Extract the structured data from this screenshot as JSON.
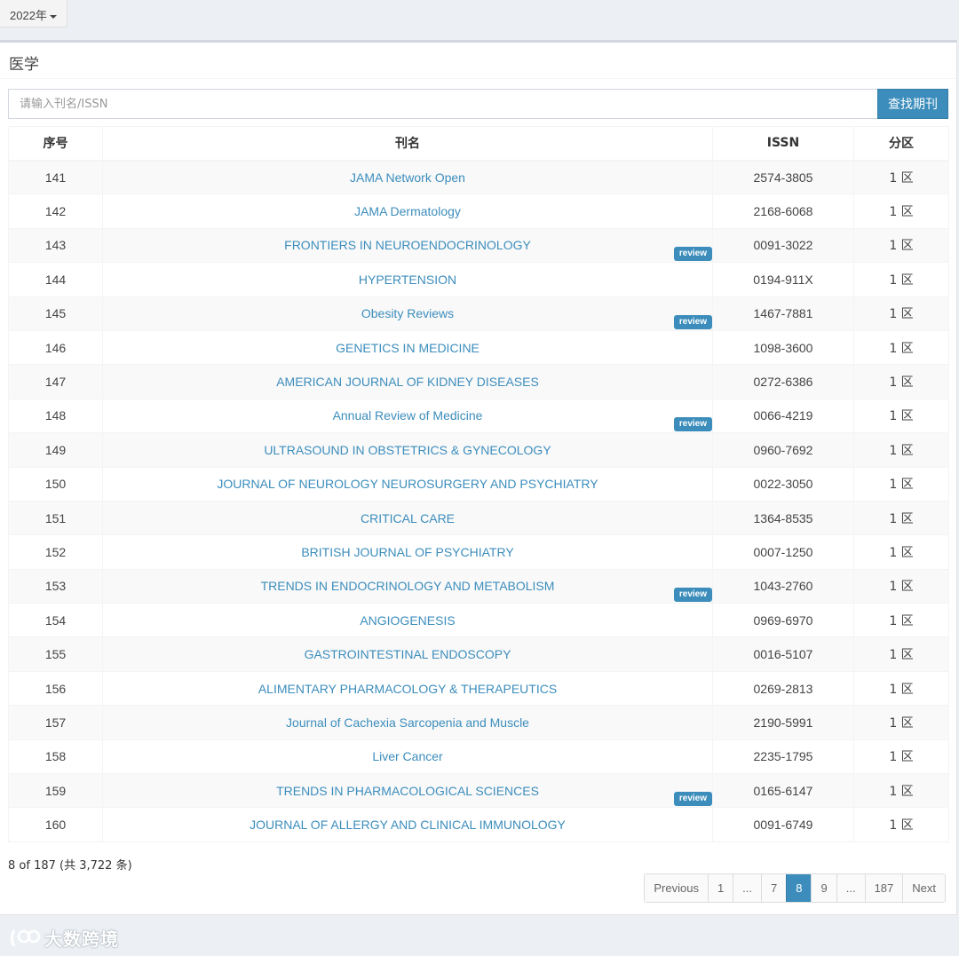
{
  "year_selector": {
    "label": "2022年"
  },
  "section": {
    "title": "医学"
  },
  "search": {
    "placeholder": "请输入刊名/ISSN",
    "button_label": "查找期刊"
  },
  "table": {
    "headers": {
      "no": "序号",
      "name": "刊名",
      "issn": "ISSN",
      "zone": "分区"
    },
    "rows": [
      {
        "no": "141",
        "name": "JAMA Network Open",
        "issn": "2574-3805",
        "zone": "1 区",
        "review": ""
      },
      {
        "no": "142",
        "name": "JAMA Dermatology",
        "issn": "2168-6068",
        "zone": "1 区",
        "review": ""
      },
      {
        "no": "143",
        "name": "FRONTIERS IN NEUROENDOCRINOLOGY",
        "issn": "0091-3022",
        "zone": "1 区",
        "review": "review"
      },
      {
        "no": "144",
        "name": "HYPERTENSION",
        "issn": "0194-911X",
        "zone": "1 区",
        "review": ""
      },
      {
        "no": "145",
        "name": "Obesity Reviews",
        "issn": "1467-7881",
        "zone": "1 区",
        "review": "review"
      },
      {
        "no": "146",
        "name": "GENETICS IN MEDICINE",
        "issn": "1098-3600",
        "zone": "1 区",
        "review": ""
      },
      {
        "no": "147",
        "name": "AMERICAN JOURNAL OF KIDNEY DISEASES",
        "issn": "0272-6386",
        "zone": "1 区",
        "review": ""
      },
      {
        "no": "148",
        "name": "Annual Review of Medicine",
        "issn": "0066-4219",
        "zone": "1 区",
        "review": "review"
      },
      {
        "no": "149",
        "name": "ULTRASOUND IN OBSTETRICS & GYNECOLOGY",
        "issn": "0960-7692",
        "zone": "1 区",
        "review": ""
      },
      {
        "no": "150",
        "name": "JOURNAL OF NEUROLOGY NEUROSURGERY AND PSYCHIATRY",
        "issn": "0022-3050",
        "zone": "1 区",
        "review": ""
      },
      {
        "no": "151",
        "name": "CRITICAL CARE",
        "issn": "1364-8535",
        "zone": "1 区",
        "review": ""
      },
      {
        "no": "152",
        "name": "BRITISH JOURNAL OF PSYCHIATRY",
        "issn": "0007-1250",
        "zone": "1 区",
        "review": ""
      },
      {
        "no": "153",
        "name": "TRENDS IN ENDOCRINOLOGY AND METABOLISM",
        "issn": "1043-2760",
        "zone": "1 区",
        "review": "review"
      },
      {
        "no": "154",
        "name": "ANGIOGENESIS",
        "issn": "0969-6970",
        "zone": "1 区",
        "review": ""
      },
      {
        "no": "155",
        "name": "GASTROINTESTINAL ENDOSCOPY",
        "issn": "0016-5107",
        "zone": "1 区",
        "review": ""
      },
      {
        "no": "156",
        "name": "ALIMENTARY PHARMACOLOGY & THERAPEUTICS",
        "issn": "0269-2813",
        "zone": "1 区",
        "review": ""
      },
      {
        "no": "157",
        "name": "Journal of Cachexia Sarcopenia and Muscle",
        "issn": "2190-5991",
        "zone": "1 区",
        "review": ""
      },
      {
        "no": "158",
        "name": "Liver Cancer",
        "issn": "2235-1795",
        "zone": "1 区",
        "review": ""
      },
      {
        "no": "159",
        "name": "TRENDS IN PHARMACOLOGICAL SCIENCES",
        "issn": "0165-6147",
        "zone": "1 区",
        "review": "review"
      },
      {
        "no": "160",
        "name": "JOURNAL OF ALLERGY AND CLINICAL IMMUNOLOGY",
        "issn": "0091-6749",
        "zone": "1 区",
        "review": ""
      }
    ]
  },
  "info": {
    "text": "8 of 187 (共 3,722 条)"
  },
  "pagination": {
    "items": [
      {
        "label": "Previous",
        "active": false
      },
      {
        "label": "1",
        "active": false
      },
      {
        "label": "...",
        "active": false
      },
      {
        "label": "7",
        "active": false
      },
      {
        "label": "8",
        "active": true
      },
      {
        "label": "9",
        "active": false
      },
      {
        "label": "...",
        "active": false
      },
      {
        "label": "187",
        "active": false
      },
      {
        "label": "Next",
        "active": false
      }
    ]
  },
  "watermark": {
    "text": "大数跨境",
    "logo_icon": "chat-bubbles-icon"
  },
  "colors": {
    "accent": "#3c8dbc",
    "background": "#ecf0f5",
    "stripe": "#f9f9f9"
  }
}
